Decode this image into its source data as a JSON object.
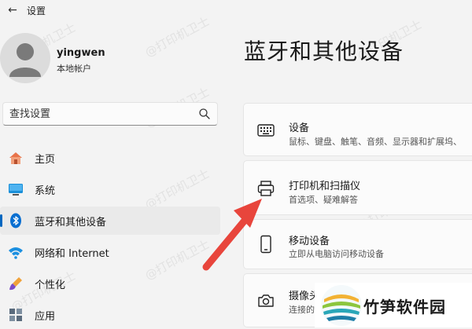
{
  "app": {
    "title": "设置",
    "back_glyph": "←"
  },
  "user": {
    "name": "yingwen",
    "account_type": "本地帐户"
  },
  "search": {
    "placeholder": "查找设置"
  },
  "sidebar": {
    "items": [
      {
        "label": "主页",
        "icon": "home-icon",
        "active": false
      },
      {
        "label": "系统",
        "icon": "monitor-icon",
        "active": false
      },
      {
        "label": "蓝牙和其他设备",
        "icon": "bluetooth-icon",
        "active": true
      },
      {
        "label": "网络和 Internet",
        "icon": "wifi-icon",
        "active": false
      },
      {
        "label": "个性化",
        "icon": "brush-icon",
        "active": false
      },
      {
        "label": "应用",
        "icon": "apps-icon",
        "active": false
      }
    ]
  },
  "main": {
    "title": "蓝牙和其他设备",
    "cards": [
      {
        "title": "设备",
        "subtitle": "鼠标、键盘、触笔、音频、显示器和扩展坞、",
        "icon": "keyboard-icon"
      },
      {
        "title": "打印机和扫描仪",
        "subtitle": "首选项、疑难解答",
        "icon": "printer-icon"
      },
      {
        "title": "移动设备",
        "subtitle": "立即从电脑访问移动设备",
        "icon": "phone-icon"
      },
      {
        "title": "摄像头",
        "subtitle": "连接的摄像头、默认图像设置",
        "icon": "camera-icon"
      }
    ]
  },
  "watermark": {
    "text": "@打印机卫士"
  },
  "logo": {
    "text": "竹笋软件园"
  },
  "colors": {
    "accent": "#0067c0",
    "arrow": "#e8453c",
    "background": "#f3f3f3",
    "card": "#fbfbfb"
  }
}
